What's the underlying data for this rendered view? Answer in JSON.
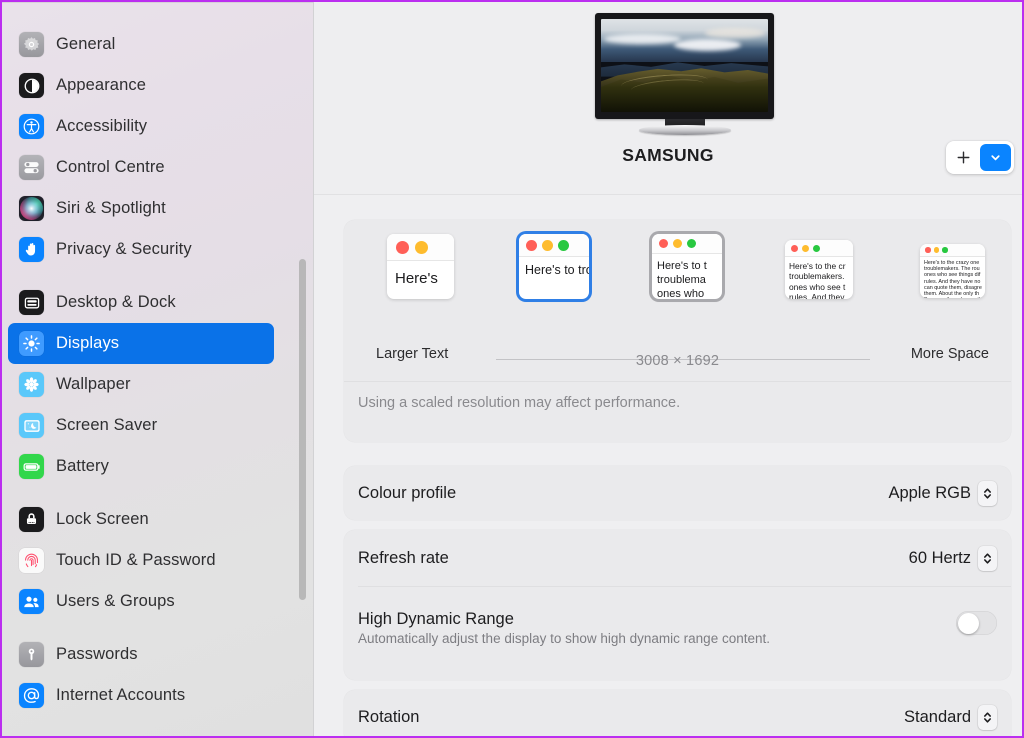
{
  "window": {
    "accent_color": "#0a72e8",
    "border_color": "#bb2ef0"
  },
  "sidebar": {
    "groups": [
      {
        "items": [
          {
            "label": "General",
            "icon": "gear-icon",
            "selected": false
          },
          {
            "label": "Appearance",
            "icon": "appearance-contrast-icon",
            "selected": false
          },
          {
            "label": "Accessibility",
            "icon": "accessibility-icon",
            "selected": false
          },
          {
            "label": "Control Centre",
            "icon": "control-centre-sliders-icon",
            "selected": false
          },
          {
            "label": "Siri & Spotlight",
            "icon": "siri-orb-icon",
            "selected": false
          },
          {
            "label": "Privacy & Security",
            "icon": "privacy-hand-icon",
            "selected": false
          }
        ]
      },
      {
        "items": [
          {
            "label": "Desktop & Dock",
            "icon": "desktop-dock-icon",
            "selected": false
          },
          {
            "label": "Displays",
            "icon": "displays-brightness-icon",
            "selected": true
          },
          {
            "label": "Wallpaper",
            "icon": "wallpaper-flower-icon",
            "selected": false
          },
          {
            "label": "Screen Saver",
            "icon": "screen-saver-icon",
            "selected": false
          },
          {
            "label": "Battery",
            "icon": "battery-icon",
            "selected": false
          }
        ]
      },
      {
        "items": [
          {
            "label": "Lock Screen",
            "icon": "lock-icon",
            "selected": false
          },
          {
            "label": "Touch ID & Password",
            "icon": "touch-id-fingerprint-icon",
            "selected": false
          },
          {
            "label": "Users & Groups",
            "icon": "users-groups-icon",
            "selected": false
          }
        ]
      },
      {
        "items": [
          {
            "label": "Passwords",
            "icon": "key-icon",
            "selected": false
          },
          {
            "label": "Internet Accounts",
            "icon": "at-sign-icon",
            "selected": false
          }
        ]
      }
    ]
  },
  "header": {
    "display_name": "SAMSUNG",
    "monitor_preview_alt": "display-wallpaper-preview",
    "add_button_label": "+",
    "add_menu_icon": "chevron-down-icon"
  },
  "scaling": {
    "thumbnails": [
      {
        "text": "Here's",
        "selected": false,
        "hovered": false
      },
      {
        "text": "Here's to troublema",
        "selected": true,
        "hovered": false
      },
      {
        "text": "Here's to t\ntroublema\nones who",
        "selected": false,
        "hovered": true
      },
      {
        "text": "Here's to the cr\ntroublemakers.\nones who see t\nrules. And they",
        "selected": false,
        "hovered": false
      },
      {
        "text": "Here's to the crazy one\ntroublemakers. The rou\nones who see things dif\nrules. And they have no\ncan quote them, disagre\nthem. About the only th\nBecause they change th",
        "selected": false,
        "hovered": false
      }
    ],
    "left_label": "Larger Text",
    "right_label": "More Space",
    "resolution": "3008 × 1692",
    "note": "Using a scaled resolution may affect performance."
  },
  "settings": {
    "colour_profile": {
      "label": "Colour profile",
      "value": "Apple RGB",
      "control": "popup-stepper"
    },
    "refresh_rate": {
      "label": "Refresh rate",
      "value": "60 Hertz",
      "control": "popup-stepper"
    },
    "hdr": {
      "label": "High Dynamic Range",
      "description": "Automatically adjust the display to show high dynamic range content.",
      "value": "off",
      "control": "switch"
    },
    "rotation": {
      "label": "Rotation",
      "value": "Standard",
      "control": "popup-stepper"
    }
  }
}
